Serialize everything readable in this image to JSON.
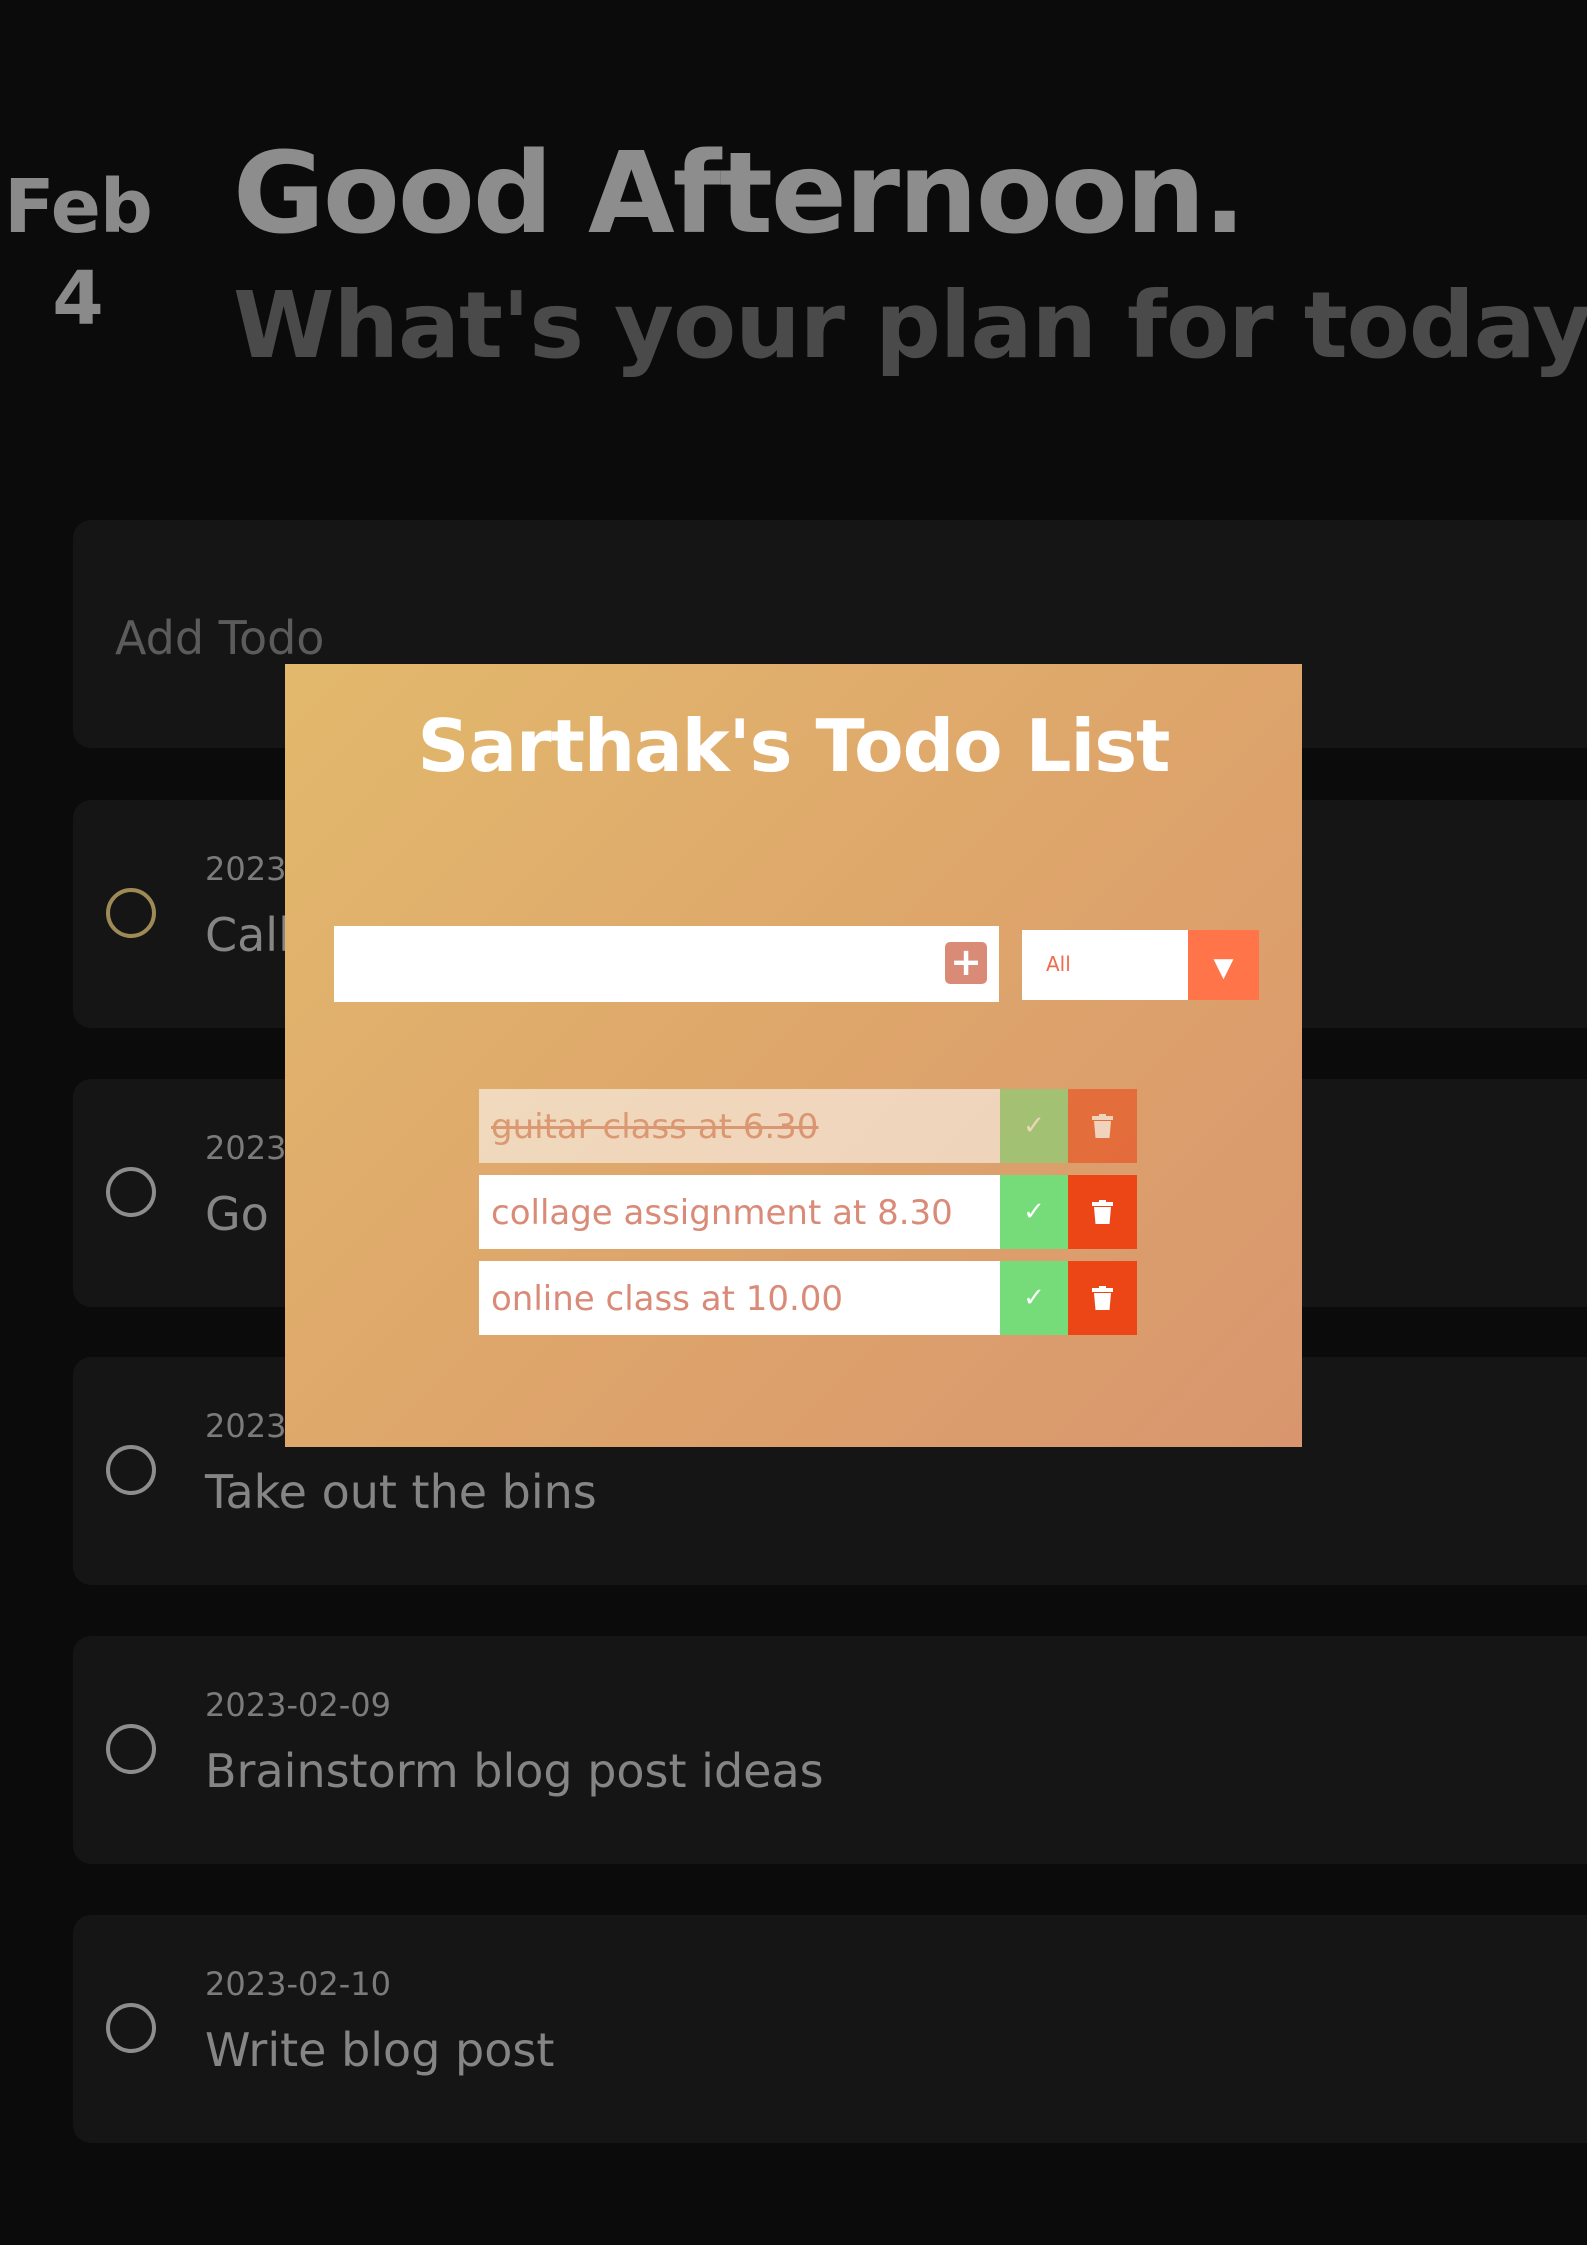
{
  "background_app": {
    "date": {
      "month": "Feb",
      "day": "4"
    },
    "greeting": "Good Afternoon.",
    "subgreeting": "What's your plan for today?",
    "add_todo_placeholder": "Add Todo",
    "todos": [
      {
        "date": "2023",
        "title": "Call",
        "state": "partial"
      },
      {
        "date": "2023",
        "title": "Go",
        "state": "partial"
      },
      {
        "date": "2023",
        "title": "Take out the bins",
        "state": "partial"
      },
      {
        "date": "2023-02-09",
        "title": "Brainstorm blog post ideas",
        "state": "full"
      },
      {
        "date": "2023-02-10",
        "title": "Write blog post",
        "state": "full"
      }
    ]
  },
  "modal": {
    "title": "Sarthak's Todo List",
    "input_value": "",
    "add_button_icon": "plus-icon",
    "filter": {
      "selected": "All",
      "arrow_icon": "caret-down-icon"
    },
    "items": [
      {
        "text": "guitar class at 6.30",
        "completed": true
      },
      {
        "text": "collage assignment at 8.30",
        "completed": false
      },
      {
        "text": "online class at 10.00",
        "completed": false
      }
    ],
    "colors": {
      "check": "#76dc7a",
      "trash": "#ec4516",
      "accent": "#ff7448",
      "text": "#d98b78"
    }
  }
}
